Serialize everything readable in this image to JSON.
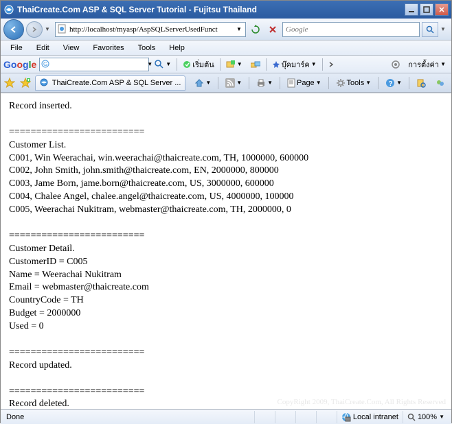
{
  "window": {
    "title": "ThaiCreate.Com ASP & SQL Server Tutorial - Fujitsu Thailand"
  },
  "nav": {
    "url": "http://localhost/myasp/AspSQLServerUsedFunct",
    "search_placeholder": "Google"
  },
  "menu": {
    "file": "File",
    "edit": "Edit",
    "view": "View",
    "favorites": "Favorites",
    "tools": "Tools",
    "help": "Help"
  },
  "gbar": {
    "logo1": "Go",
    "logo2": "o",
    "logo3": "g",
    "logo4": "l",
    "logo5": "e",
    "start": "เริ่มต้น",
    "bookmarks": "บุ๊คมาร์ค",
    "settings": "การตั้งค่า"
  },
  "tab": {
    "title": "ThaiCreate.Com ASP & SQL Server ..."
  },
  "cmdbar": {
    "page": "Page",
    "tools": "Tools"
  },
  "content": {
    "lines": [
      "Record inserted.",
      "",
      "=========================",
      "Customer List.",
      "C001, Win Weerachai, win.weerachai@thaicreate.com, TH, 1000000, 600000",
      "C002, John Smith, john.smith@thaicreate.com, EN, 2000000, 800000",
      "C003, Jame Born, jame.born@thaicreate.com, US, 3000000, 600000",
      "C004, Chalee Angel, chalee.angel@thaicreate.com, US, 4000000, 100000",
      "C005, Weerachai Nukitram, webmaster@thaicreate.com, TH, 2000000, 0",
      "",
      "=========================",
      "Customer Detail.",
      "CustomerID = C005",
      "Name = Weerachai Nukitram",
      "Email = webmaster@thaicreate.com",
      "CountryCode = TH",
      "Budget = 2000000",
      "Used = 0",
      "",
      "=========================",
      "Record updated.",
      "",
      "=========================",
      "Record deleted."
    ],
    "watermark": "CopyRight 2009, ThaiCreate.Com, All Rights Reserved"
  },
  "status": {
    "text": "Done",
    "zone": "Local intranet",
    "zoom": "100%"
  }
}
